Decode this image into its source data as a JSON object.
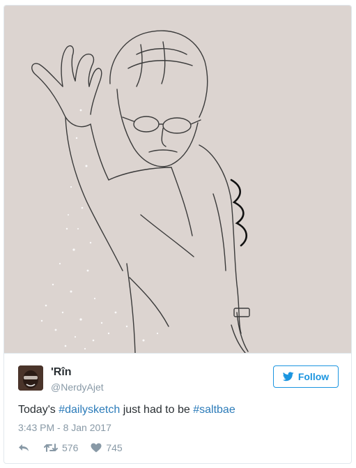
{
  "tweet": {
    "user": {
      "display_name": "'Rîn",
      "screen_name": "@NerdyAjet"
    },
    "follow_label": "Follow",
    "text": {
      "prefix": "Today's ",
      "hashtag1": "#dailysketch",
      "middle": " just had to be ",
      "hashtag2": "#saltbae"
    },
    "timestamp": "3:43 PM - 8 Jan 2017",
    "retweet_count": "576",
    "like_count": "745"
  },
  "colors": {
    "brand_blue": "#1b95e0",
    "hashtag_blue": "#2b7bb9",
    "muted_gray": "#8899a6",
    "sketch_background": "#dcd4d0"
  },
  "icons": {
    "follow": "twitter-bird-icon",
    "reply": "reply-icon",
    "retweet": "retweet-icon",
    "like": "heart-icon"
  }
}
